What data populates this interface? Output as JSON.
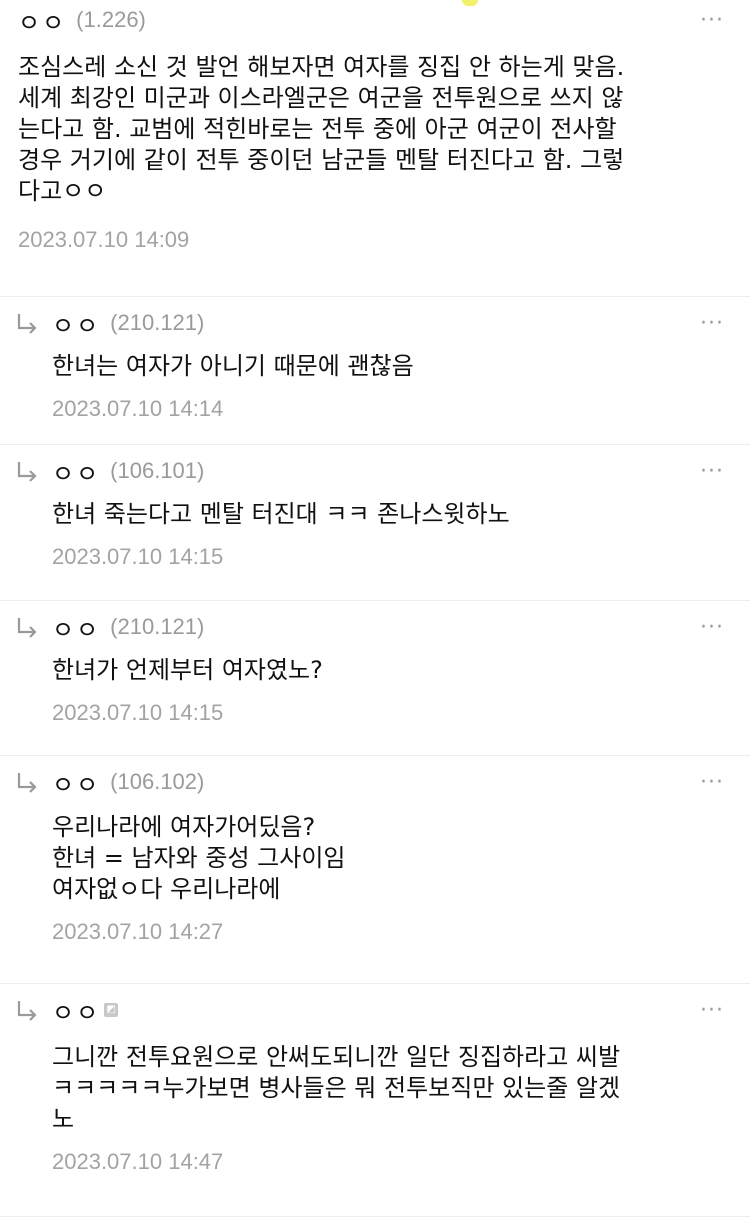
{
  "comments": [
    {
      "nick": "ㅇㅇ",
      "ip": "(1.226)",
      "body": "조심스레 소신 것 발언 해보자면 여자를 징집 안 하는게 맞음.\n세계 최강인 미군과 이스라엘군은 여군을 전투원으로 쓰지 않\n는다고 함. 교범에 적힌바로는 전투 중에 아군 여군이 전사할\n경우 거기에 같이 전투 중이던 남군들 멘탈 터진다고 함. 그렇\n다고ㅇㅇ",
      "date": "2023.07.10 14:09",
      "more": "···"
    }
  ],
  "replies": [
    {
      "nick": "ㅇㅇ",
      "ip": "(210.121)",
      "body": "한녀는 여자가 아니기 때문에 괜찮음",
      "date": "2023.07.10 14:14",
      "more": "···"
    },
    {
      "nick": "ㅇㅇ",
      "ip": "(106.101)",
      "body": "한녀 죽는다고 멘탈 터진대 ㅋㅋ 존나스윗하노",
      "date": "2023.07.10 14:15",
      "more": "···"
    },
    {
      "nick": "ㅇㅇ",
      "ip": "(210.121)",
      "body": "한녀가 언제부터 여자였노?",
      "date": "2023.07.10 14:15",
      "more": "···"
    },
    {
      "nick": "ㅇㅇ",
      "ip": "(106.102)",
      "body": "우리나라에 여자가어딨음?\n한녀 = 남자와 중성 그사이임\n여자없ㅇ다 우리나라에",
      "date": "2023.07.10 14:27",
      "more": "···"
    },
    {
      "nick": "ㅇㅇ",
      "ip": "",
      "body": "그니깐 전투요원으로 안써도되니깐 일단 징집하라고 씨발\nㅋㅋㅋㅋㅋ누가보면 병사들은 뭐 전투보직만 있는줄 알겠\n노",
      "date": "2023.07.10 14:47",
      "more": "···"
    }
  ]
}
